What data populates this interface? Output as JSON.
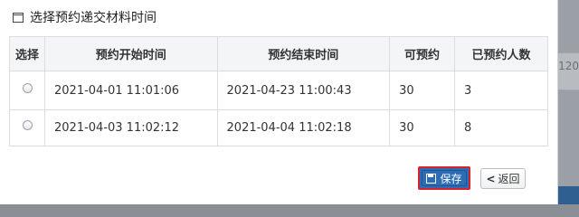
{
  "background": {
    "partial_text": "120"
  },
  "modal": {
    "title": "选择预约递交材料时间"
  },
  "table": {
    "headers": [
      "选择",
      "预约开始时间",
      "预约结束时间",
      "可预约",
      "已预约人数"
    ],
    "rows": [
      {
        "start": "2021-04-01 11:01:06",
        "end": "2021-04-23 11:00:43",
        "available": "30",
        "booked": "3"
      },
      {
        "start": "2021-04-03 11:02:12",
        "end": "2021-04-04 11:02:18",
        "available": "30",
        "booked": "8"
      }
    ]
  },
  "buttons": {
    "save_label": "保存",
    "back_label": "返回"
  },
  "colors": {
    "primary": "#2d6db5",
    "highlight": "#d9232a"
  }
}
